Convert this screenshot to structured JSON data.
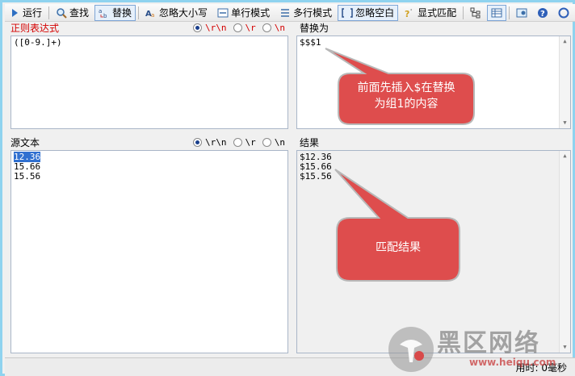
{
  "toolbar": {
    "run": "运行",
    "find": "查找",
    "replace": "替换",
    "ignore_case": "忽略大小写",
    "single_line": "单行模式",
    "multi_line": "多行模式",
    "ignore_whitespace": "忽略空白",
    "explicit_match": "显式匹配"
  },
  "regex_panel": {
    "title": "正则表达式",
    "radio_options": [
      "\\r\\n",
      "\\r",
      "\\n"
    ],
    "selected": "\\r\\n",
    "value": "([0-9.]+)"
  },
  "replace_panel": {
    "title": "替换为",
    "value": "$$$1"
  },
  "source_panel": {
    "title": "源文本",
    "radio_options": [
      "\\r\\n",
      "\\r",
      "\\n"
    ],
    "selected": "\\r\\n",
    "lines": [
      "12.36",
      "15.66",
      "15.56"
    ]
  },
  "result_panel": {
    "title": "结果",
    "lines": [
      "$12.36",
      "$15.66",
      "$15.56"
    ]
  },
  "callouts": {
    "replace_note_line1": "前面先插入$在替换",
    "replace_note_line2": "为组1的内容",
    "result_note": "匹配结果",
    "fill_color": "#de4d4d"
  },
  "statusbar": {
    "time": "用时: 0毫秒"
  },
  "watermark": {
    "cn": "黑区网络",
    "en": "www.heiqu.com"
  },
  "colors": {
    "accent_red": "#d40000",
    "selection": "#3070d0"
  }
}
